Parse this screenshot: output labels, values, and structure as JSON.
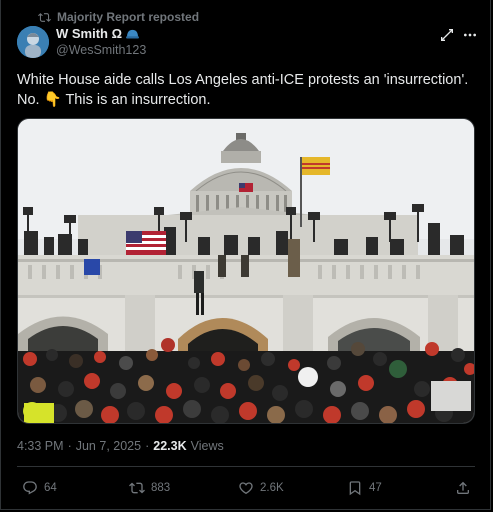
{
  "repost": {
    "label": "Majority Report reposted"
  },
  "author": {
    "name": "W Smith Ω",
    "handle": "@WesSmith123",
    "badge_icon": "helmet-emoji-icon"
  },
  "tweet": {
    "line1": "White House aide calls Los Angeles anti-ICE protests an 'insurrection'.",
    "line2_pre": "No.",
    "line2_emoji": "👇",
    "line2_post": "This is an insurrection."
  },
  "media": {
    "description_icon": "photo-capitol-crowd"
  },
  "meta": {
    "time": "4:33 PM",
    "separator": "·",
    "date": "Jun 7, 2025",
    "views_count": "22.3K",
    "views_label": "Views"
  },
  "actions": {
    "replies": "64",
    "reposts": "883",
    "likes": "2.6K",
    "bookmarks": "47"
  },
  "colors": {
    "background": "#000000",
    "text": "#e7e9ea",
    "muted": "#71767b",
    "border": "#2f3336",
    "accent": "#1d9bf0"
  }
}
